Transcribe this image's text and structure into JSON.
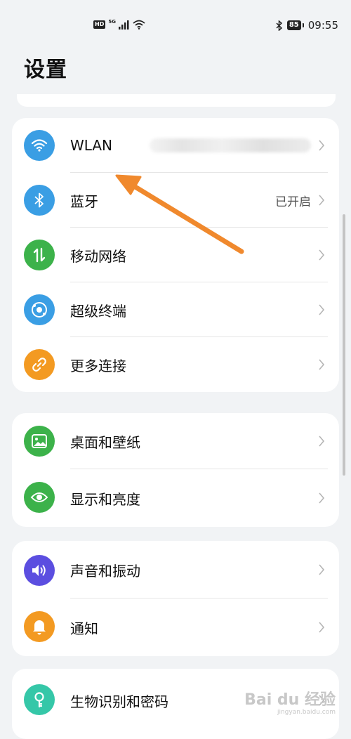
{
  "status_bar": {
    "hd": "HD",
    "network": "5G",
    "battery": "85",
    "time": "09:55"
  },
  "title": "设置",
  "groups": [
    {
      "items": [
        {
          "label": "WLAN",
          "value_blurred": true,
          "icon": "wifi-icon",
          "color": "#3a9ee4"
        },
        {
          "label": "蓝牙",
          "value": "已开启",
          "icon": "bluetooth-icon",
          "color": "#3a9ee4"
        },
        {
          "label": "移动网络",
          "icon": "mobile-network-icon",
          "color": "#3cb24a"
        },
        {
          "label": "超级终端",
          "icon": "super-device-icon",
          "color": "#3a9ee4"
        },
        {
          "label": "更多连接",
          "icon": "link-icon",
          "color": "#f39a22"
        }
      ]
    },
    {
      "items": [
        {
          "label": "桌面和壁纸",
          "icon": "wallpaper-icon",
          "color": "#3cb24a"
        },
        {
          "label": "显示和亮度",
          "icon": "eye-icon",
          "color": "#3cb24a"
        }
      ]
    },
    {
      "items": [
        {
          "label": "声音和振动",
          "icon": "sound-icon",
          "color": "#5b4ee0"
        },
        {
          "label": "通知",
          "icon": "bell-icon",
          "color": "#f39a22"
        }
      ]
    },
    {
      "items": [
        {
          "label": "生物识别和密码",
          "icon": "key-icon",
          "color": "#35c7a8"
        }
      ]
    }
  ],
  "colors": {
    "background": "#f1f3f5",
    "annotation_arrow": "#f0892d"
  },
  "watermark": {
    "main": "Bai du 经验",
    "sub": "jingyan.baidu.com"
  }
}
